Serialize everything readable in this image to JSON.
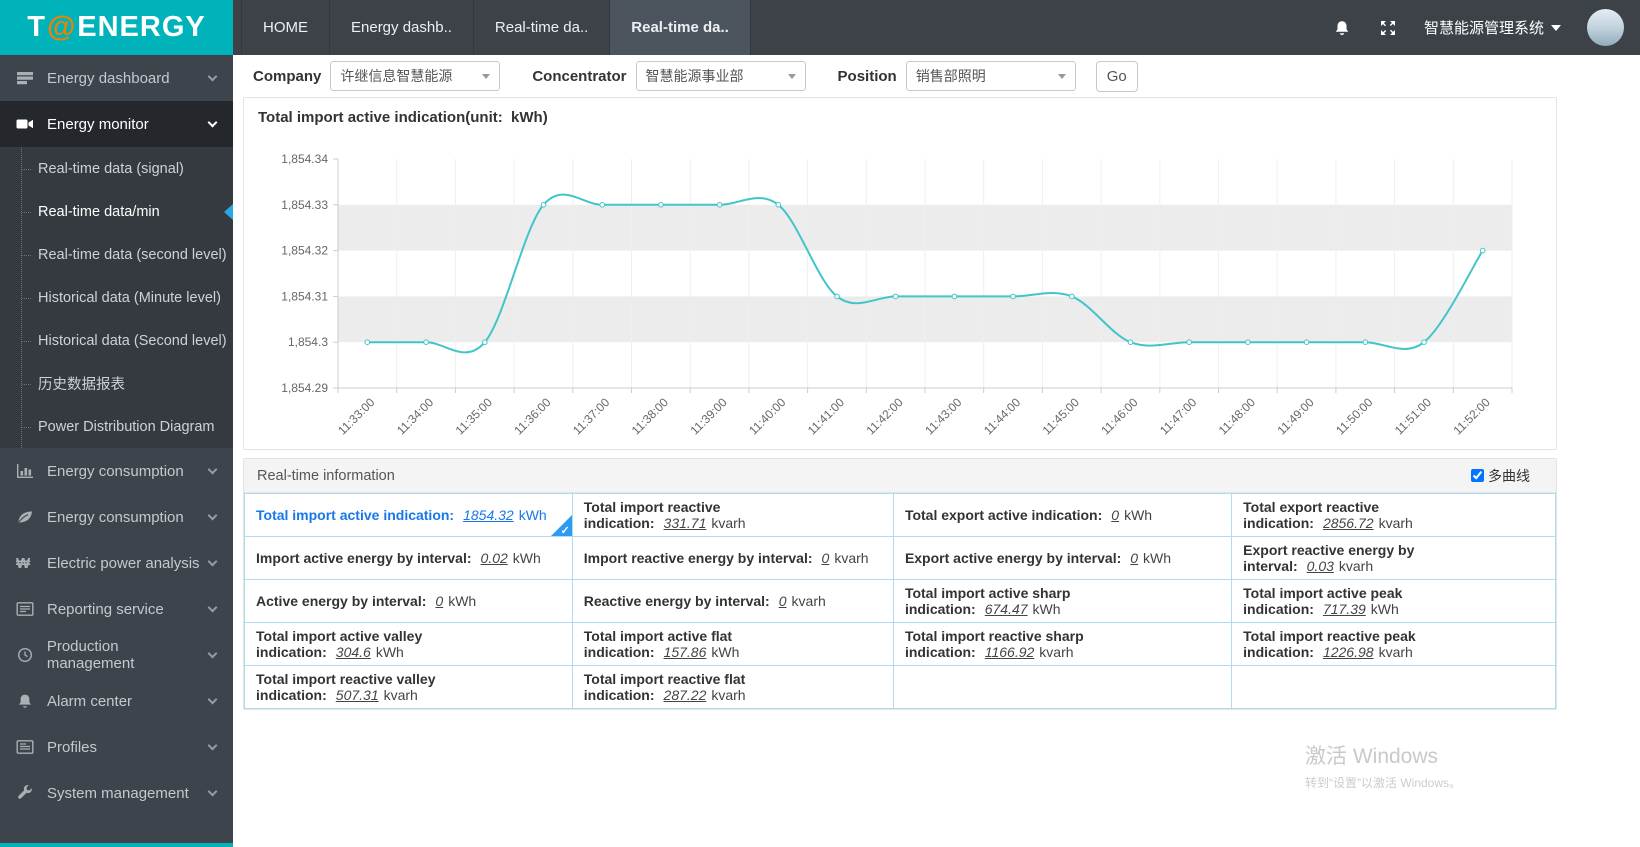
{
  "header": {
    "logo_t": "T",
    "logo_at": "@",
    "logo_rest": "ENERGY",
    "tabs": [
      {
        "label": "HOME",
        "active": false
      },
      {
        "label": "Energy dashb..",
        "active": false
      },
      {
        "label": "Real-time da..",
        "active": false
      },
      {
        "label": "Real-time da..",
        "active": true
      }
    ],
    "system_title": "智慧能源管理系统"
  },
  "sidebar": {
    "items": [
      {
        "label": "Energy dashboard",
        "icon": "dashboard-icon"
      },
      {
        "label": "Energy monitor",
        "icon": "video-camera-icon",
        "active": true
      },
      {
        "label": "Energy consumption",
        "icon": "bar-chart-icon"
      },
      {
        "label": "Energy consumption",
        "icon": "leaf-icon"
      },
      {
        "label": "Electric power analysis",
        "icon": "won-icon"
      },
      {
        "label": "Reporting service",
        "icon": "report-icon"
      },
      {
        "label": "Production management",
        "icon": "clock-icon"
      },
      {
        "label": "Alarm center",
        "icon": "bell-icon"
      },
      {
        "label": "Profiles",
        "icon": "document-icon"
      },
      {
        "label": "System management",
        "icon": "wrench-icon"
      }
    ],
    "submenu": [
      {
        "label": "Real-time data (signal)",
        "active": false
      },
      {
        "label": "Real-time data/min",
        "active": true
      },
      {
        "label": "Real-time data (second level)",
        "active": false
      },
      {
        "label": "Historical data (Minute level)",
        "active": false
      },
      {
        "label": "Historical data (Second level)",
        "active": false
      },
      {
        "label": "历史数据报表",
        "active": false
      },
      {
        "label": "Power Distribution Diagram",
        "active": false
      }
    ]
  },
  "filters": {
    "company": {
      "label": "Company",
      "value": "许继信息智慧能源"
    },
    "concentrator": {
      "label": "Concentrator",
      "value": "智慧能源事业部"
    },
    "position": {
      "label": "Position",
      "value": "销售部照明"
    },
    "go_label": "Go"
  },
  "chart_data": {
    "type": "line",
    "title": "Total import active indication(unit:  kWh)",
    "x": [
      "11:33:00",
      "11:34:00",
      "11:35:00",
      "11:36:00",
      "11:37:00",
      "11:38:00",
      "11:39:00",
      "11:40:00",
      "11:41:00",
      "11:42:00",
      "11:43:00",
      "11:44:00",
      "11:45:00",
      "11:46:00",
      "11:47:00",
      "11:48:00",
      "11:49:00",
      "11:50:00",
      "11:51:00",
      "11:52:00"
    ],
    "values": [
      1854.3,
      1854.3,
      1854.3,
      1854.33,
      1854.33,
      1854.33,
      1854.33,
      1854.33,
      1854.31,
      1854.31,
      1854.31,
      1854.31,
      1854.31,
      1854.3,
      1854.3,
      1854.3,
      1854.3,
      1854.3,
      1854.3,
      1854.32
    ],
    "ylim": [
      1854.29,
      1854.34
    ],
    "y_ticks": [
      "1,854.29",
      "1,854.3",
      "1,854.31",
      "1,854.32",
      "1,854.33",
      "1,854.34"
    ],
    "stripe_bands": [
      [
        1854.3,
        1854.31
      ],
      [
        1854.32,
        1854.33
      ]
    ],
    "line_color": "#41c5c9",
    "stripe_color": "#ececec",
    "grid": true,
    "legend": "none"
  },
  "panel": {
    "title": "Real-time information",
    "multi_curve_label": "多曲线",
    "multi_curve_checked": true,
    "rows": [
      [
        {
          "label": "Total import active indication:",
          "value": "1854.32",
          "unit": "kWh",
          "selected": true
        },
        {
          "label": "Total import reactive indication:",
          "value": "331.71",
          "unit": "kvarh"
        },
        {
          "label": "Total export active indication:",
          "value": "0",
          "unit": "kWh"
        },
        {
          "label": "Total export reactive indication:",
          "value": "2856.72",
          "unit": "kvarh"
        }
      ],
      [
        {
          "label": "Import active energy by interval:",
          "value": "0.02",
          "unit": "kWh"
        },
        {
          "label": "Import reactive energy by interval:",
          "value": "0",
          "unit": "kvarh"
        },
        {
          "label": "Export active energy by interval:",
          "value": "0",
          "unit": "kWh"
        },
        {
          "label": "Export reactive energy by interval:",
          "value": "0.03",
          "unit": "kvarh"
        }
      ],
      [
        {
          "label": "Active energy by interval:",
          "value": "0",
          "unit": "kWh"
        },
        {
          "label": "Reactive energy by interval:",
          "value": "0",
          "unit": "kvarh"
        },
        {
          "label": "Total import active sharp indication:",
          "value": "674.47",
          "unit": "kWh"
        },
        {
          "label": "Total import active peak indication:",
          "value": "717.39",
          "unit": "kWh"
        }
      ],
      [
        {
          "label": "Total import active valley indication:",
          "value": "304.6",
          "unit": "kWh"
        },
        {
          "label": "Total import active flat indication:",
          "value": "157.86",
          "unit": "kWh"
        },
        {
          "label": "Total import reactive sharp indication:",
          "value": "1166.92",
          "unit": "kvarh"
        },
        {
          "label": "Total import reactive peak indication:",
          "value": "1226.98",
          "unit": "kvarh"
        }
      ],
      [
        {
          "label": "Total import reactive valley indication:",
          "value": "507.31",
          "unit": "kvarh"
        },
        {
          "label": "Total import reactive flat indication:",
          "value": "287.22",
          "unit": "kvarh"
        },
        null,
        null
      ]
    ]
  },
  "watermark": {
    "line1": "激活 Windows",
    "line2": "转到“设置”以激活 Windows。"
  }
}
